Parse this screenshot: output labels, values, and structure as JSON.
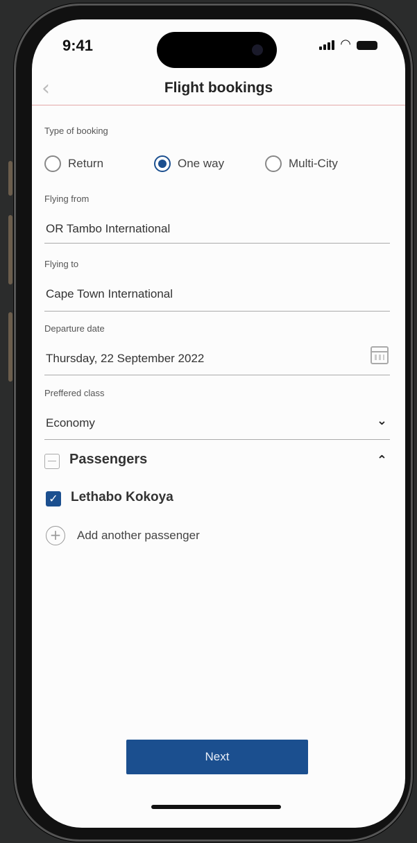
{
  "status_bar": {
    "time": "9:41"
  },
  "header": {
    "title": "Flight bookings"
  },
  "booking_type": {
    "label": "Type of booking",
    "options": [
      "Return",
      "One way",
      "Multi-City"
    ],
    "selected": "One way"
  },
  "flying_from": {
    "label": "Flying from",
    "value": "OR Tambo International"
  },
  "flying_to": {
    "label": "Flying to",
    "value": "Cape Town International"
  },
  "departure_date": {
    "label": "Departure date",
    "value": "Thursday, 22 September 2022"
  },
  "preferred_class": {
    "label": "Preffered class",
    "value": "Economy"
  },
  "passengers": {
    "label": "Passengers",
    "list": [
      {
        "name": "Lethabo Kokoya",
        "checked": true
      }
    ],
    "add_label": "Add another passenger"
  },
  "footer": {
    "next_label": "Next"
  },
  "colors": {
    "primary": "#1b4f8f",
    "divider_accent": "#e4a8a8",
    "background": "#2b2c2c"
  },
  "icons": [
    "chevron-left-icon",
    "signal-icon",
    "wifi-icon",
    "battery-icon",
    "calendar-icon",
    "chevron-down-icon",
    "minus-box-icon",
    "chevron-up-icon",
    "checkbox-checked-icon",
    "plus-circle-icon"
  ]
}
